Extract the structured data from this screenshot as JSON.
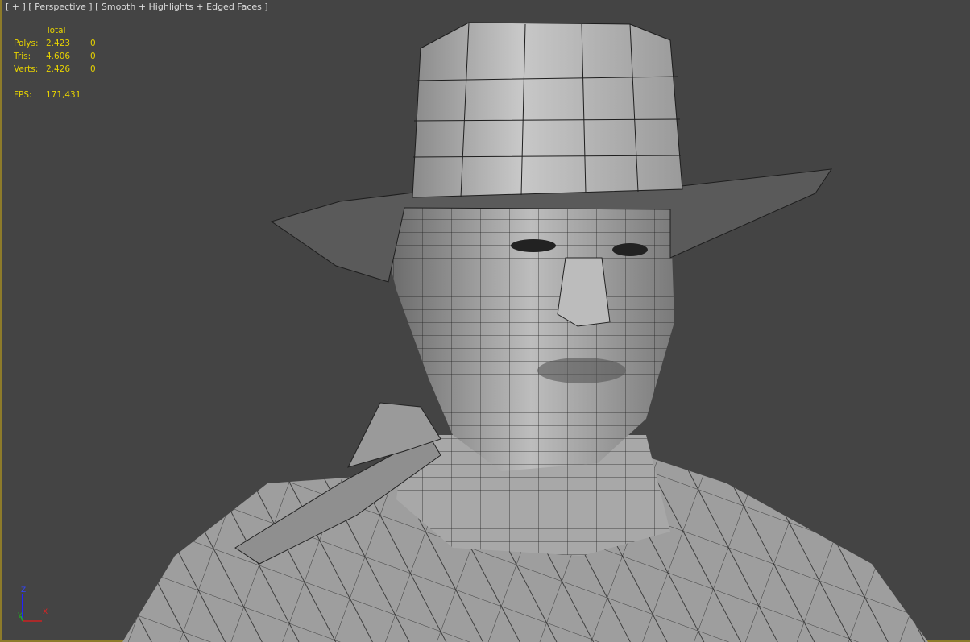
{
  "viewport": {
    "label_plus": "[ + ]",
    "label_view": "[ Perspective ]",
    "label_shading": "[ Smooth + Highlights + Edged Faces ]"
  },
  "stats": {
    "header": "Total",
    "rows": [
      {
        "label": "Polys:",
        "total": "2.423",
        "selected": "0"
      },
      {
        "label": "Tris:",
        "total": "4.606",
        "selected": "0"
      },
      {
        "label": "Verts:",
        "total": "2.426",
        "selected": "0"
      }
    ],
    "fps_label": "FPS:",
    "fps_value": "171,431"
  },
  "gizmo": {
    "x": "X",
    "y": "Y",
    "z": "Z"
  },
  "colors": {
    "background": "#444444",
    "stats": "#e6d200",
    "border": "#8d7b2a"
  }
}
